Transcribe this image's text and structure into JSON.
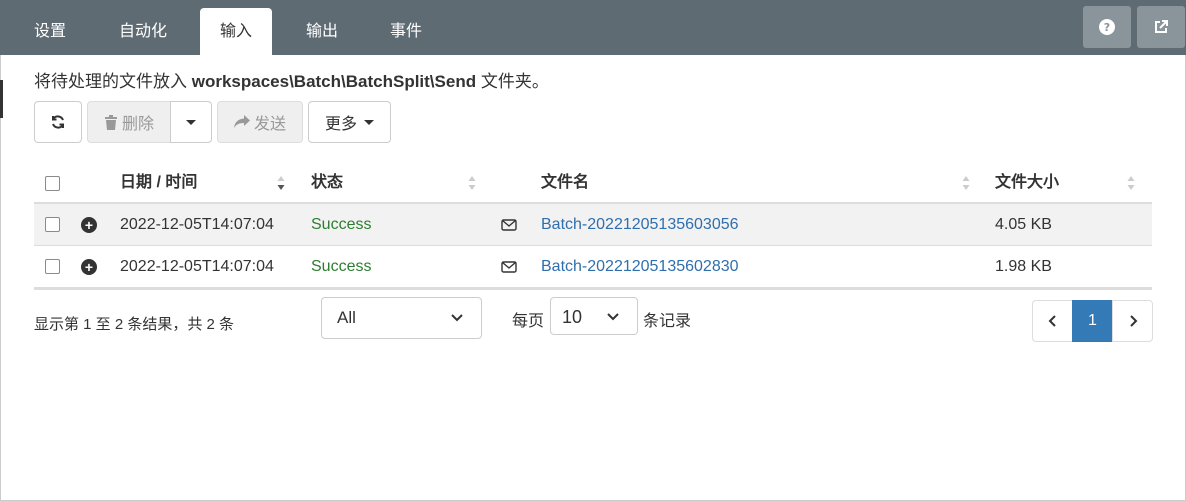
{
  "tabs": [
    {
      "label": "设置"
    },
    {
      "label": "自动化"
    },
    {
      "label": "输入",
      "active": true
    },
    {
      "label": "输出"
    },
    {
      "label": "事件"
    }
  ],
  "top_buttons": {
    "help_icon": "question-circle-icon",
    "external_icon": "external-link-icon"
  },
  "info": {
    "prefix": "将待处理的文件放入 ",
    "path": "workspaces\\Batch\\BatchSplit\\Send",
    "suffix": " 文件夹。"
  },
  "toolbar": {
    "refresh_icon": "refresh-icon",
    "delete_label": "删除",
    "send_label": "发送",
    "more_label": "更多"
  },
  "table": {
    "headers": {
      "date": "日期 / 时间",
      "status": "状态",
      "filename": "文件名",
      "size": "文件大小"
    },
    "rows": [
      {
        "date": "2022-12-05T14:07:04",
        "status": "Success",
        "filename": "Batch-20221205135603056",
        "size": "4.05 KB"
      },
      {
        "date": "2022-12-05T14:07:04",
        "status": "Success",
        "filename": "Batch-20221205135602830",
        "size": "1.98 KB"
      }
    ]
  },
  "footer": {
    "summary": "显示第 1 至 2 条结果，共 2 条",
    "filter_value": "All",
    "per_page_prefix": "每页",
    "per_page_value": "10",
    "per_page_suffix": "条记录",
    "current_page": "1"
  },
  "colors": {
    "topbar": "#5f6b73",
    "success": "#2e7d32",
    "link": "#2f6fad",
    "active_page": "#337ab7"
  }
}
